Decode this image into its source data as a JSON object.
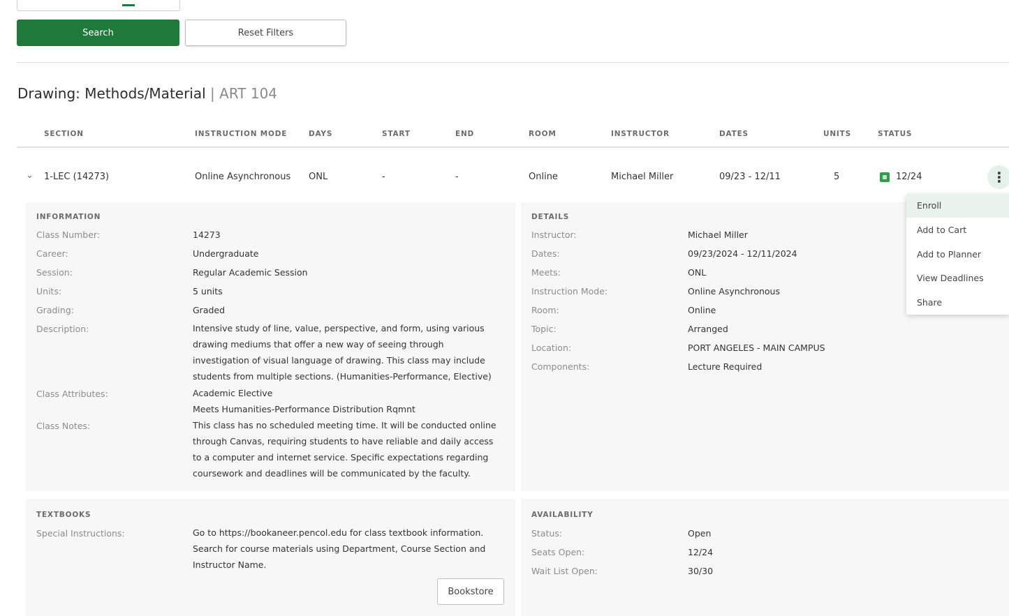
{
  "filters": {
    "search_label": "Search",
    "reset_label": "Reset Filters"
  },
  "course": {
    "title": "Drawing: Methods/Material",
    "separator": "|",
    "code": "ART 104"
  },
  "table": {
    "headers": [
      "SECTION",
      "INSTRUCTION MODE",
      "DAYS",
      "START",
      "END",
      "ROOM",
      "INSTRUCTOR",
      "DATES",
      "UNITS",
      "STATUS"
    ],
    "row": {
      "section": "1-LEC (14273)",
      "mode": "Online Asynchronous",
      "days": "ONL",
      "start": "-",
      "end": "-",
      "room": "Online",
      "instructor": "Michael Miller",
      "dates": "09/23 - 12/11",
      "units": "5",
      "status": "12/24"
    }
  },
  "information": {
    "heading": "INFORMATION",
    "class_number_label": "Class Number:",
    "class_number": "14273",
    "career_label": "Career:",
    "career": "Undergraduate",
    "session_label": "Session:",
    "session": "Regular Academic Session",
    "units_label": "Units:",
    "units": "5 units",
    "grading_label": "Grading:",
    "grading": "Graded",
    "description_label": "Description:",
    "description_lines": [
      "Intensive study of line, value, perspective, and form, using various",
      "drawing mediums that offer a new way of seeing through",
      "investigation of visual language of drawing. This class may include",
      "students from multiple sections. (Humanities-Performance, Elective)"
    ],
    "attributes_label": "Class Attributes:",
    "attributes_lines": [
      "Academic Elective",
      "Meets Humanities-Performance Distribution Rqmnt"
    ],
    "notes_label": "Class Notes:",
    "notes_lines": [
      "This class has no scheduled meeting time. It will be conducted online",
      "through Canvas, requiring students to have reliable and daily access",
      "to a computer and internet service. Specific expectations regarding",
      "coursework and deadlines will be communicated by the faculty."
    ]
  },
  "details": {
    "heading": "DETAILS",
    "instructor_label": "Instructor:",
    "instructor": "Michael Miller",
    "dates_label": "Dates:",
    "dates": "09/23/2024 - 12/11/2024",
    "meets_label": "Meets:",
    "meets": "ONL",
    "mode_label": "Instruction Mode:",
    "mode": "Online Asynchronous",
    "room_label": "Room:",
    "room": "Online",
    "topic_label": "Topic:",
    "topic": "Arranged",
    "location_label": "Location:",
    "location": "PORT ANGELES - MAIN CAMPUS",
    "components_label": "Components:",
    "components": "Lecture Required"
  },
  "textbooks": {
    "heading": "TEXTBOOKS",
    "special_label": "Special Instructions:",
    "special_lines": [
      "Go to https://bookaneer.pencol.edu for class textbook information.",
      "Search for course materials using Department, Course Section and",
      "Instructor Name."
    ],
    "bookstore_label": "Bookstore"
  },
  "availability": {
    "heading": "AVAILABILITY",
    "status_label": "Status:",
    "status": "Open",
    "seats_label": "Seats Open:",
    "seats": "12/24",
    "waitlist_label": "Wait List Open:",
    "waitlist": "30/30"
  },
  "menu": {
    "items": [
      "Enroll",
      "Add to Cart",
      "Add to Planner",
      "View Deadlines",
      "Share"
    ]
  },
  "colors": {
    "primary_green": "#1f7a3a",
    "status_green": "#2f9e4c"
  }
}
